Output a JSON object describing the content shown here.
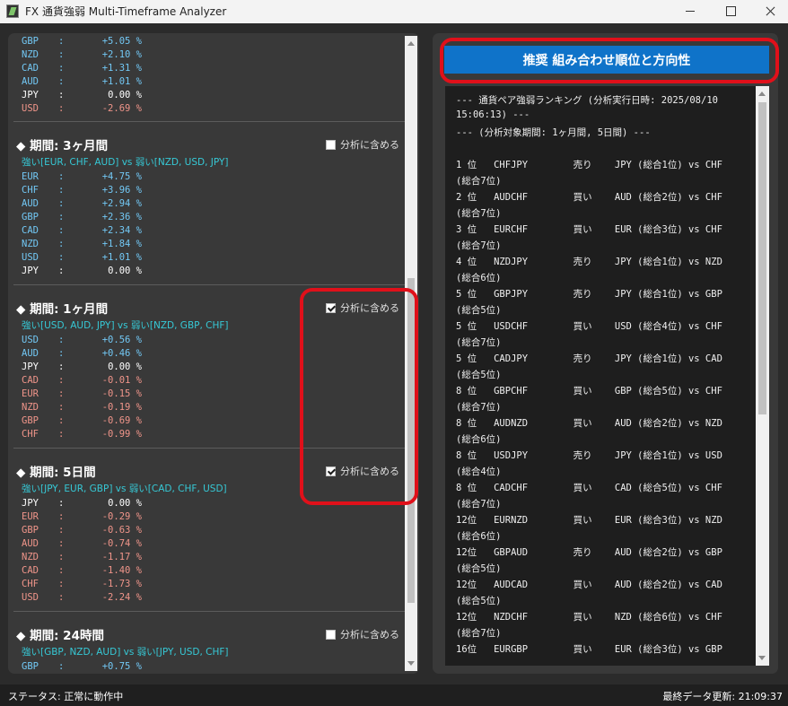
{
  "window": {
    "title": "FX 通貨強弱 Multi-Timeframe Analyzer",
    "icon": "app-icon",
    "controls": [
      "minimize",
      "maximize",
      "close"
    ]
  },
  "colors": {
    "positive": "#72c8f5",
    "negative": "#f0958a",
    "zero": "#ffffff",
    "strength_summary": "#36c9d6",
    "button": "#0f73c9",
    "highlight": "#e0101a"
  },
  "left_panel": {
    "top_list": [
      {
        "currency": "GBP",
        "sep": ":",
        "value": "+5.05 %",
        "sign": "pos"
      },
      {
        "currency": "NZD",
        "sep": ":",
        "value": "+2.10 %",
        "sign": "pos"
      },
      {
        "currency": "CAD",
        "sep": ":",
        "value": "+1.31 %",
        "sign": "pos"
      },
      {
        "currency": "AUD",
        "sep": ":",
        "value": "+1.01 %",
        "sign": "pos"
      },
      {
        "currency": "JPY",
        "sep": ":",
        "value": "0.00 %",
        "sign": "zero"
      },
      {
        "currency": "USD",
        "sep": ":",
        "value": "-2.69 %",
        "sign": "neg"
      }
    ],
    "periods": [
      {
        "title": "◆ 期間: 3ヶ月間",
        "include_label": "分析に含める",
        "include_checked": false,
        "summary": "強い[EUR, CHF, AUD] vs 弱い[NZD, USD, JPY]",
        "rows": [
          {
            "currency": "EUR",
            "sep": ":",
            "value": "+4.75 %",
            "sign": "pos"
          },
          {
            "currency": "CHF",
            "sep": ":",
            "value": "+3.96 %",
            "sign": "pos"
          },
          {
            "currency": "AUD",
            "sep": ":",
            "value": "+2.94 %",
            "sign": "pos"
          },
          {
            "currency": "GBP",
            "sep": ":",
            "value": "+2.36 %",
            "sign": "pos"
          },
          {
            "currency": "CAD",
            "sep": ":",
            "value": "+2.34 %",
            "sign": "pos"
          },
          {
            "currency": "NZD",
            "sep": ":",
            "value": "+1.84 %",
            "sign": "pos"
          },
          {
            "currency": "USD",
            "sep": ":",
            "value": "+1.01 %",
            "sign": "pos"
          },
          {
            "currency": "JPY",
            "sep": ":",
            "value": "0.00 %",
            "sign": "zero"
          }
        ]
      },
      {
        "title": "◆ 期間: 1ヶ月間",
        "include_label": "分析に含める",
        "include_checked": true,
        "summary": "強い[USD, AUD, JPY] vs 弱い[NZD, GBP, CHF]",
        "rows": [
          {
            "currency": "USD",
            "sep": ":",
            "value": "+0.56 %",
            "sign": "pos"
          },
          {
            "currency": "AUD",
            "sep": ":",
            "value": "+0.46 %",
            "sign": "pos"
          },
          {
            "currency": "JPY",
            "sep": ":",
            "value": "0.00 %",
            "sign": "zero"
          },
          {
            "currency": "CAD",
            "sep": ":",
            "value": "-0.01 %",
            "sign": "neg"
          },
          {
            "currency": "EUR",
            "sep": ":",
            "value": "-0.15 %",
            "sign": "neg"
          },
          {
            "currency": "NZD",
            "sep": ":",
            "value": "-0.19 %",
            "sign": "neg"
          },
          {
            "currency": "GBP",
            "sep": ":",
            "value": "-0.69 %",
            "sign": "neg"
          },
          {
            "currency": "CHF",
            "sep": ":",
            "value": "-0.99 %",
            "sign": "neg"
          }
        ]
      },
      {
        "title": "◆ 期間: 5日間",
        "include_label": "分析に含める",
        "include_checked": true,
        "summary": "強い[JPY, EUR, GBP] vs 弱い[CAD, CHF, USD]",
        "rows": [
          {
            "currency": "JPY",
            "sep": ":",
            "value": "0.00 %",
            "sign": "zero"
          },
          {
            "currency": "EUR",
            "sep": ":",
            "value": "-0.29 %",
            "sign": "neg"
          },
          {
            "currency": "GBP",
            "sep": ":",
            "value": "-0.63 %",
            "sign": "neg"
          },
          {
            "currency": "AUD",
            "sep": ":",
            "value": "-0.74 %",
            "sign": "neg"
          },
          {
            "currency": "NZD",
            "sep": ":",
            "value": "-1.17 %",
            "sign": "neg"
          },
          {
            "currency": "CAD",
            "sep": ":",
            "value": "-1.40 %",
            "sign": "neg"
          },
          {
            "currency": "CHF",
            "sep": ":",
            "value": "-1.73 %",
            "sign": "neg"
          },
          {
            "currency": "USD",
            "sep": ":",
            "value": "-2.24 %",
            "sign": "neg"
          }
        ]
      },
      {
        "title": "◆ 期間: 24時間",
        "include_label": "分析に含める",
        "include_checked": false,
        "summary": "強い[GBP, NZD, AUD] vs 弱い[JPY, USD, CHF]",
        "rows": [
          {
            "currency": "GBP",
            "sep": ":",
            "value": "+0.75 %",
            "sign": "pos"
          }
        ]
      }
    ]
  },
  "right_panel": {
    "button_label": "推奨 組み合わせ順位と方向性",
    "ranking_lines": [
      "--- 通貨ペア強弱ランキング (分析実行日時: 2025/08/10",
      "15:06:13) ---",
      "--- (分析対象期間: 1ヶ月間, 5日間) ---",
      "",
      "1 位   CHFJPY        売り    JPY (総合1位) vs CHF",
      "(総合7位)",
      "2 位   AUDCHF        買い    AUD (総合2位) vs CHF",
      "(総合7位)",
      "3 位   EURCHF        買い    EUR (総合3位) vs CHF",
      "(総合7位)",
      "4 位   NZDJPY        売り    JPY (総合1位) vs NZD",
      "(総合6位)",
      "5 位   GBPJPY        売り    JPY (総合1位) vs GBP",
      "(総合5位)",
      "5 位   USDCHF        買い    USD (総合4位) vs CHF",
      "(総合7位)",
      "5 位   CADJPY        売り    JPY (総合1位) vs CAD",
      "(総合5位)",
      "8 位   GBPCHF        買い    GBP (総合5位) vs CHF",
      "(総合7位)",
      "8 位   AUDNZD        買い    AUD (総合2位) vs NZD",
      "(総合6位)",
      "8 位   USDJPY        売り    JPY (総合1位) vs USD",
      "(総合4位)",
      "8 位   CADCHF        買い    CAD (総合5位) vs CHF",
      "(総合7位)",
      "12位   EURNZD        買い    EUR (総合3位) vs NZD",
      "(総合6位)",
      "12位   GBPAUD        売り    AUD (総合2位) vs GBP",
      "(総合5位)",
      "12位   AUDCAD        買い    AUD (総合2位) vs CAD",
      "(総合5位)",
      "12位   NZDCHF        買い    NZD (総合6位) vs CHF",
      "(総合7位)",
      "16位   EURGBP        買い    EUR (総合3位) vs GBP"
    ]
  },
  "status_bar": {
    "status": "ステータス: 正常に動作中",
    "last_update": "最終データ更新: 21:09:37"
  }
}
